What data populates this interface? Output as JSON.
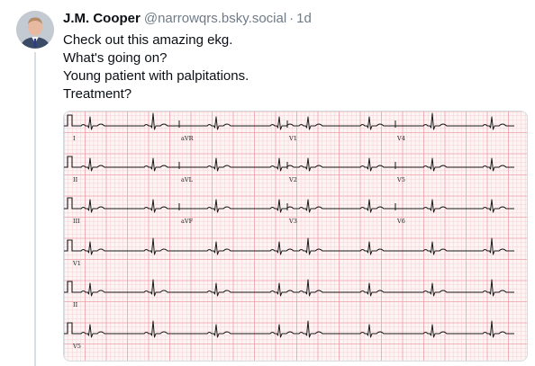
{
  "post": {
    "author_name": "J.M. Cooper",
    "handle": "@narrowqrs.bsky.social",
    "separator": "·",
    "time_ago": "1d",
    "text_lines": [
      "Check out this amazing ekg.",
      "What's going on?",
      "Young patient with palpitations.",
      "Treatment?"
    ]
  },
  "ekg": {
    "lead_rows": [
      [
        "I",
        "aVR",
        "V1",
        "V4"
      ],
      [
        "II",
        "aVL",
        "V2",
        "V5"
      ],
      [
        "III",
        "aVF",
        "V3",
        "V6"
      ]
    ],
    "rhythm_strips": [
      "V1",
      "II",
      "V5"
    ]
  },
  "colors": {
    "grid_minor": "#f6cfd3",
    "grid_major": "#ee9ea8",
    "trace": "#1a1a1a",
    "text_primary": "#0b0f14",
    "text_secondary": "#6f7b87"
  }
}
